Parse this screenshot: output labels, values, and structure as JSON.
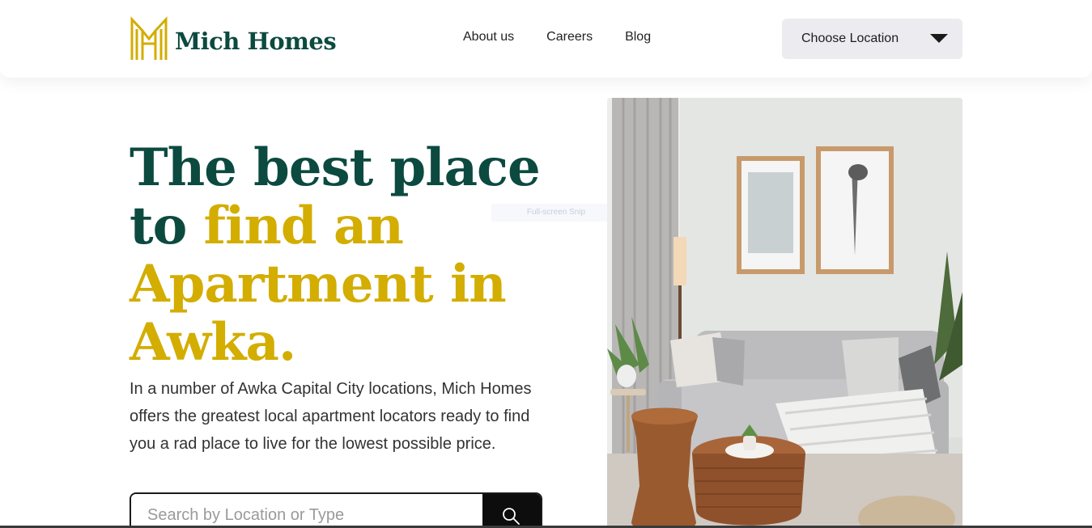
{
  "brand": {
    "name": "Mich Homes",
    "logo_icon": "mh-monogram-icon",
    "dark": "#0c4a40",
    "gold": "#d3ad00"
  },
  "nav": {
    "items": [
      {
        "label": "About us"
      },
      {
        "label": "Careers"
      },
      {
        "label": "Blog"
      }
    ]
  },
  "location_button": {
    "label": "Choose Location",
    "icon": "caret-down-icon"
  },
  "hero": {
    "headline_dark_1": "The best place",
    "headline_dark_2": "to ",
    "headline_gold_1": "find an",
    "headline_gold_2": "Apartment in",
    "headline_gold_3": "Awka.",
    "description": "In a number of Awka Capital City locations, Mich Homes offers the greatest local apartment locators ready to find you a rad place to live for the lowest possible price."
  },
  "search": {
    "placeholder": "Search by Location or Type",
    "value": "",
    "icon": "search-icon"
  },
  "overlay": {
    "snip_label": "Full-screen Snip"
  },
  "photo": {
    "alt": "Living room interior with grey sofa, framed art, and wooden tables"
  }
}
